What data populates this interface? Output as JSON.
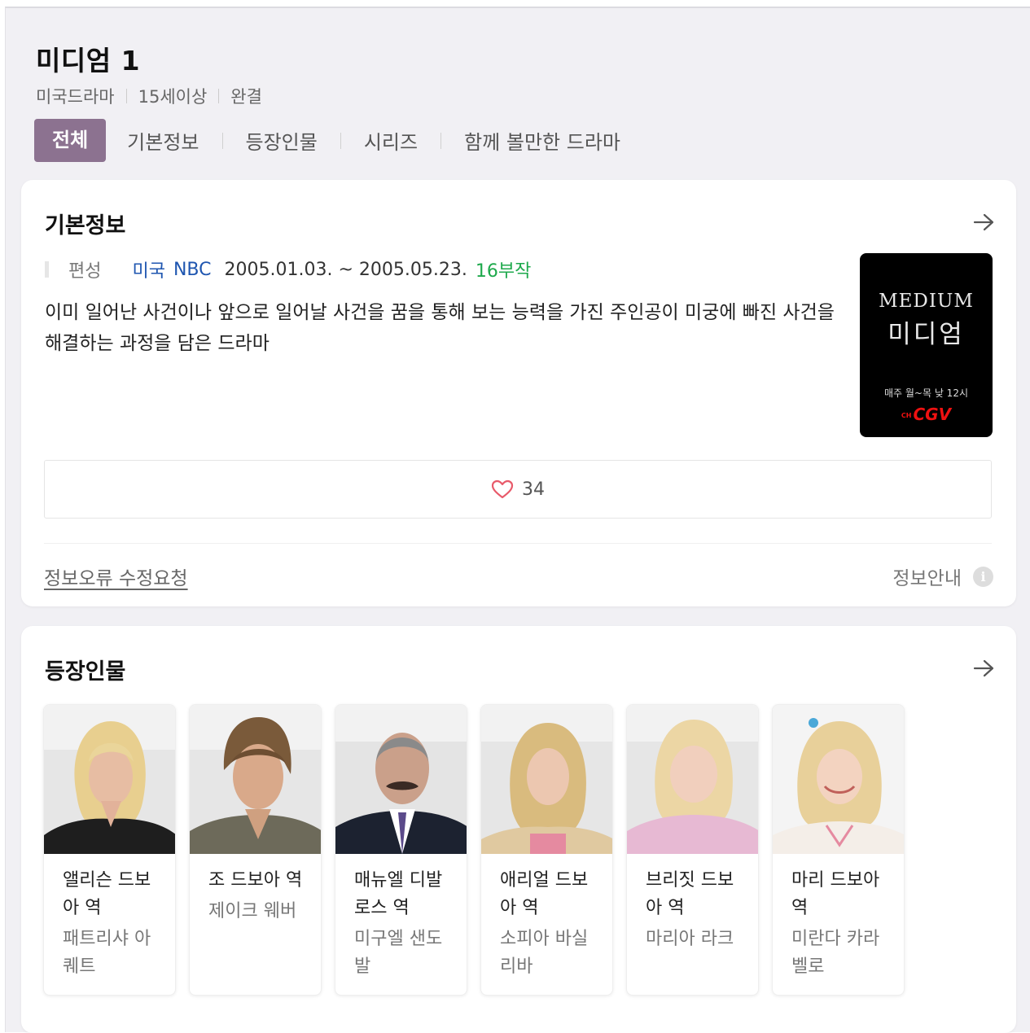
{
  "header": {
    "title": "미디엄 1",
    "meta": [
      "미국드라마",
      "15세이상",
      "완결"
    ]
  },
  "tabs": [
    {
      "label": "전체",
      "active": true
    },
    {
      "label": "기본정보",
      "active": false
    },
    {
      "label": "등장인물",
      "active": false
    },
    {
      "label": "시리즈",
      "active": false
    },
    {
      "label": "함께 볼만한 드라마",
      "active": false
    }
  ],
  "info": {
    "title": "기본정보",
    "label": "편성",
    "country": "미국",
    "network": "NBC",
    "dates": "2005.01.03. ~ 2005.05.23.",
    "episodes": "16부작",
    "description": "이미 일어난 사건이나 앞으로 일어날 사건을 꿈을 통해 보는 능력을 가진 주인공이 미궁에 빠진 사건을 해결하는 과정을 담은 드라마",
    "poster": {
      "title_en": "MEDIUM",
      "title_ko": "미디엄",
      "schedule": "매주 월~목 낮 12시",
      "logo_prefix": "CH",
      "logo": "CGV"
    },
    "likes": "34",
    "report_label": "정보오류 수정요청",
    "guide_label": "정보안내",
    "guide_icon": "i"
  },
  "cast": {
    "title": "등장인물",
    "people": [
      {
        "role": "앨리슨 드보아 역",
        "actor": "패트리샤 아퀘트"
      },
      {
        "role": "조 드보아 역",
        "actor": "제이크 웨버"
      },
      {
        "role": "매뉴엘 디발로스 역",
        "actor": "미구엘 샌도발"
      },
      {
        "role": "애리얼 드보아 역",
        "actor": "소피아 바실리바"
      },
      {
        "role": "브리짓 드보아 역",
        "actor": "마리아 라크"
      },
      {
        "role": "마리 드보아 역",
        "actor": "미란다 카라벨로"
      }
    ]
  },
  "colors": {
    "accent": "#8c7290",
    "link": "#1f56b0",
    "episodes": "#1ea94c",
    "heart": "#e85a6a"
  }
}
